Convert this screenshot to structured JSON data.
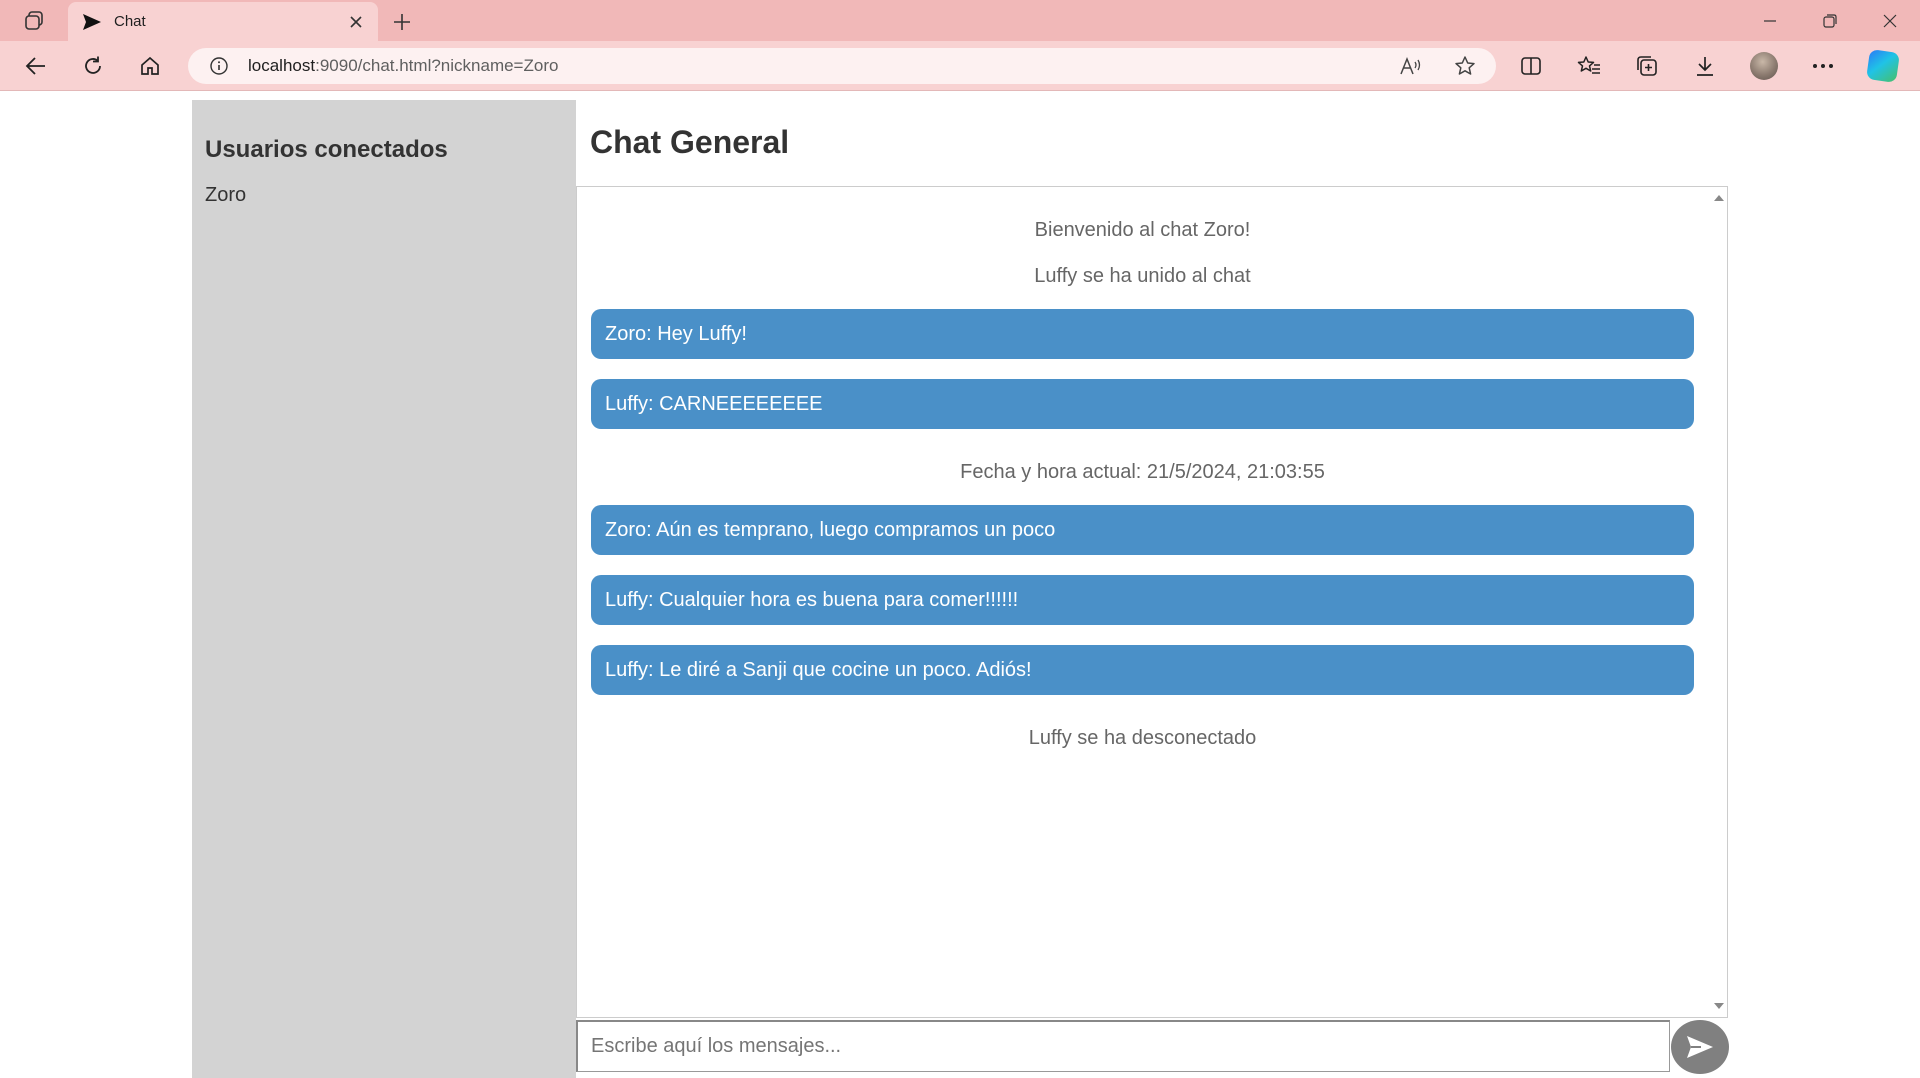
{
  "browser": {
    "tab_title": "Chat",
    "url_host": "localhost",
    "url_path": ":9090/chat.html?nickname=Zoro",
    "theme_color": "#f1b8b8"
  },
  "sidebar": {
    "heading": "Usuarios conectados",
    "users": [
      "Zoro"
    ]
  },
  "chat": {
    "title": "Chat General",
    "messages": [
      {
        "kind": "system",
        "text": "Bienvenido al chat Zoro!"
      },
      {
        "kind": "system",
        "text": "Luffy se ha unido al chat"
      },
      {
        "kind": "user",
        "text": "Zoro: Hey Luffy!"
      },
      {
        "kind": "user",
        "text": "Luffy: CARNEEEEEEEE"
      },
      {
        "kind": "system",
        "text": "Fecha y hora actual: 21/5/2024, 21:03:55"
      },
      {
        "kind": "user",
        "text": "Zoro: Aún es temprano, luego compramos un poco"
      },
      {
        "kind": "user",
        "text": "Luffy: Cualquier hora es buena para comer!!!!!!"
      },
      {
        "kind": "user",
        "text": "Luffy: Le diré a Sanji que cocine un poco. Adiós!"
      },
      {
        "kind": "system",
        "text": "Luffy se ha desconectado"
      }
    ],
    "input_placeholder": "Escribe aquí los mensajes...",
    "bubble_color": "#4a90c8"
  }
}
